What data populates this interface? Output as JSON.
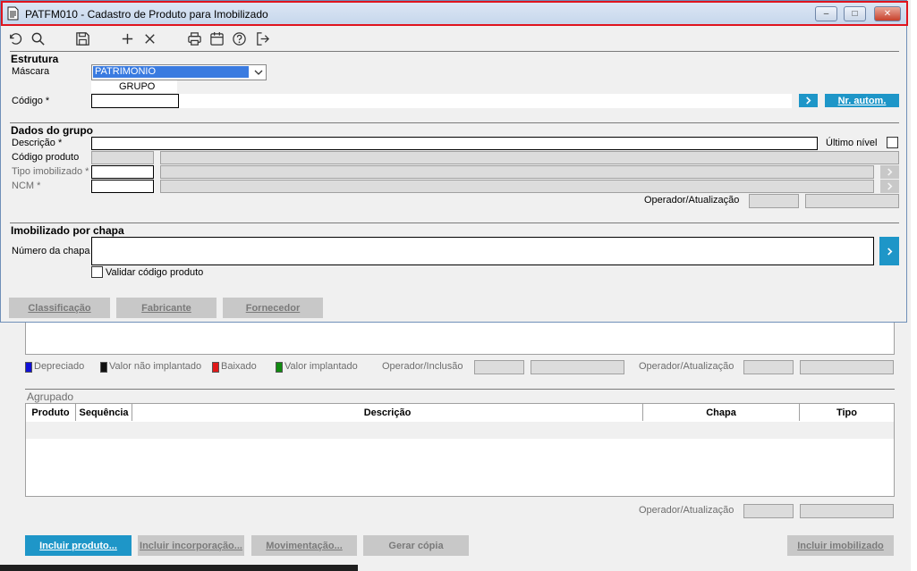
{
  "window": {
    "title": "PATFM010 - Cadastro de Produto para Imobilizado",
    "minimize_glyph": "–",
    "maximize_glyph": "□",
    "close_glyph": "✕"
  },
  "icons": {
    "window_icon": "document-icon",
    "undo": "undo-icon",
    "search": "search-icon",
    "save": "save-icon",
    "add": "plus-icon",
    "delete": "close-icon",
    "print": "printer-icon",
    "calendar": "calendar-icon",
    "help": "help-icon",
    "exit": "exit-icon",
    "chevron": "chevron-right-icon",
    "dropdown": "chevron-down-icon"
  },
  "colors": {
    "accent": "#1e96c8",
    "title_border": "#e0141e",
    "legend_depreciado": "#1010d8",
    "legend_nao_implantado": "#101010",
    "legend_baixado": "#e01818",
    "legend_implantado": "#108a10"
  },
  "estrutura": {
    "section_title": "Estrutura",
    "mascara_label": "Máscara",
    "mascara_value": "PATRIMONIO",
    "mascara_option": "GRUPO",
    "codigo_label": "Código *",
    "codigo_value": "",
    "nr_autom_label": "Nr. autom."
  },
  "dados_grupo": {
    "section_title": "Dados do grupo",
    "descricao_label": "Descrição *",
    "ultimo_nivel_label": "Último nível",
    "codigo_produto_label": "Código produto",
    "tipo_imobilizado_label": "Tipo imobilizado *",
    "ncm_label": "NCM *",
    "operador_atualizacao_label": "Operador/Atualização"
  },
  "chapa": {
    "section_title": "Imobilizado por chapa",
    "numero_label": "Número da chapa",
    "validar_label": "Validar código produto"
  },
  "dialog_buttons": {
    "classificacao": "Classificação",
    "fabricante": "Fabricante",
    "fornecedor": "Fornecedor"
  },
  "legend": {
    "depreciado": "Depreciado",
    "nao_implantado": "Valor não implantado",
    "baixado": "Baixado",
    "implantado": "Valor implantado",
    "operador_inclusao_label": "Operador/Inclusão",
    "operador_atualizacao_label": "Operador/Atualização"
  },
  "agrupado": {
    "section_title": "Agrupado",
    "columns": [
      "Produto",
      "Sequência",
      "Descrição",
      "Chapa",
      "Tipo"
    ],
    "operador_atualizacao_label": "Operador/Atualização"
  },
  "footer_buttons": {
    "incluir_produto": "Incluir produto...",
    "incluir_incorporacao": "Incluir incorporação...",
    "movimentacao": "Movimentação...",
    "gerar_copia": "Gerar cópia",
    "incluir_imobilizado": "Incluir imobilizado"
  }
}
